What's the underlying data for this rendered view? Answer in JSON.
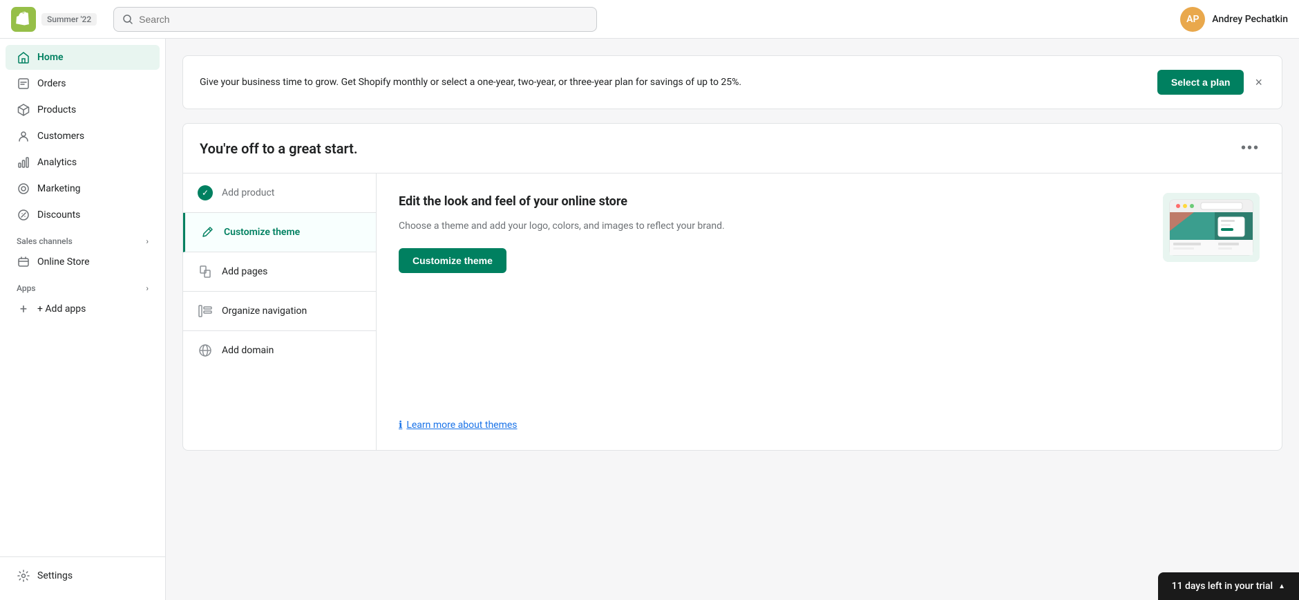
{
  "topbar": {
    "logo_alt": "Shopify",
    "badge": "Summer '22",
    "search_placeholder": "Search",
    "user_initials": "AP",
    "username": "Andrey Pechatkin"
  },
  "sidebar": {
    "nav_items": [
      {
        "id": "home",
        "label": "Home",
        "icon": "home-icon",
        "active": true
      },
      {
        "id": "orders",
        "label": "Orders",
        "icon": "orders-icon",
        "active": false
      },
      {
        "id": "products",
        "label": "Products",
        "icon": "products-icon",
        "active": false
      },
      {
        "id": "customers",
        "label": "Customers",
        "icon": "customers-icon",
        "active": false
      },
      {
        "id": "analytics",
        "label": "Analytics",
        "icon": "analytics-icon",
        "active": false
      },
      {
        "id": "marketing",
        "label": "Marketing",
        "icon": "marketing-icon",
        "active": false
      },
      {
        "id": "discounts",
        "label": "Discounts",
        "icon": "discounts-icon",
        "active": false
      }
    ],
    "sales_channels_label": "Sales channels",
    "online_store_label": "Online Store",
    "apps_label": "Apps",
    "add_apps_label": "+ Add apps",
    "settings_label": "Settings"
  },
  "banner": {
    "text": "Give your business time to grow. Get Shopify monthly or select a one-year, two-year, or three-year plan for savings of up to 25%.",
    "cta_label": "Select a plan"
  },
  "setup_card": {
    "title": "You're off to a great start.",
    "steps": [
      {
        "id": "add-product",
        "label": "Add product",
        "completed": true,
        "active": false
      },
      {
        "id": "customize-theme",
        "label": "Customize theme",
        "completed": false,
        "active": true
      },
      {
        "id": "add-pages",
        "label": "Add pages",
        "completed": false,
        "active": false
      },
      {
        "id": "organize-navigation",
        "label": "Organize navigation",
        "completed": false,
        "active": false
      },
      {
        "id": "add-domain",
        "label": "Add domain",
        "completed": false,
        "active": false
      }
    ],
    "detail": {
      "title": "Edit the look and feel of your online store",
      "description": "Choose a theme and add your logo, colors, and images to reflect your brand.",
      "cta_label": "Customize theme",
      "learn_more_label": "Learn more about themes"
    }
  },
  "trial": {
    "label": "11 days left in your trial",
    "arrow": "▲"
  }
}
